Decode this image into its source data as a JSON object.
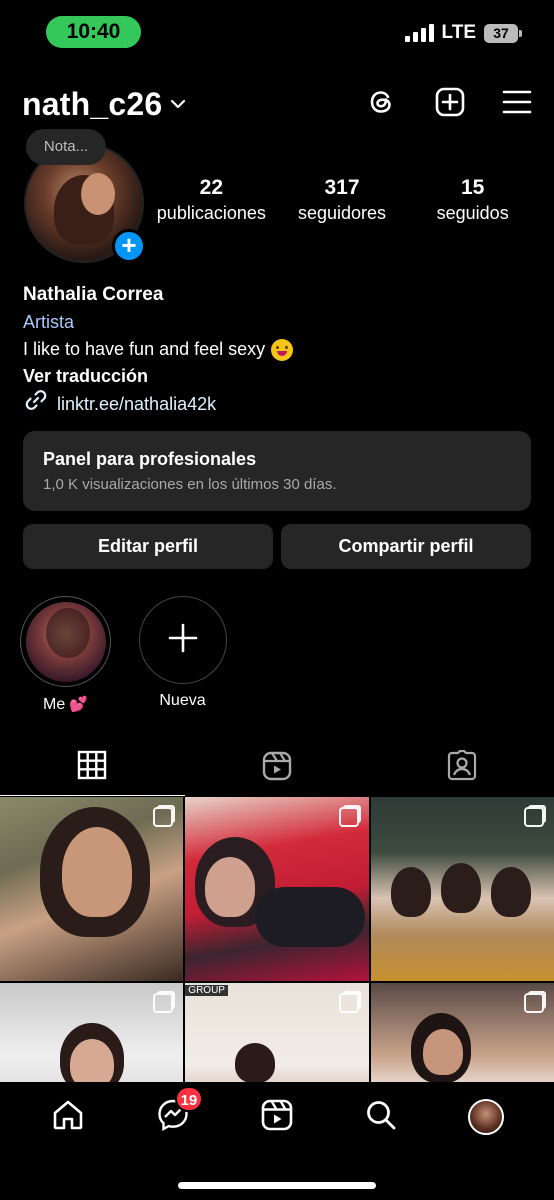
{
  "status_bar": {
    "time": "10:40",
    "network": "LTE",
    "battery": "37"
  },
  "header": {
    "username": "nath_c26"
  },
  "profile": {
    "note": "Nota...",
    "stats": [
      {
        "count": "22",
        "label": "publicaciones"
      },
      {
        "count": "317",
        "label": "seguidores"
      },
      {
        "count": "15",
        "label": "seguidos"
      }
    ],
    "name": "Nathalia Correa",
    "category": "Artista",
    "bio": "I like to have fun and feel sexy",
    "translate": "Ver traducción",
    "link": "linktr.ee/nathalia42k"
  },
  "panel": {
    "title": "Panel para profesionales",
    "subtitle": "1,0 K visualizaciones en los últimos 30 días."
  },
  "buttons": {
    "edit": "Editar perfil",
    "share": "Compartir perfil"
  },
  "highlights": [
    {
      "label": "Me"
    },
    {
      "label": "Nueva"
    }
  ],
  "grid": {
    "group_tag": "GROUP"
  },
  "bottom_nav": {
    "messages_badge": "19"
  },
  "colors": {
    "accent_blue": "#0095f6",
    "time_pill": "#34c759",
    "badge_red": "#ff3040",
    "surface": "#262626"
  }
}
